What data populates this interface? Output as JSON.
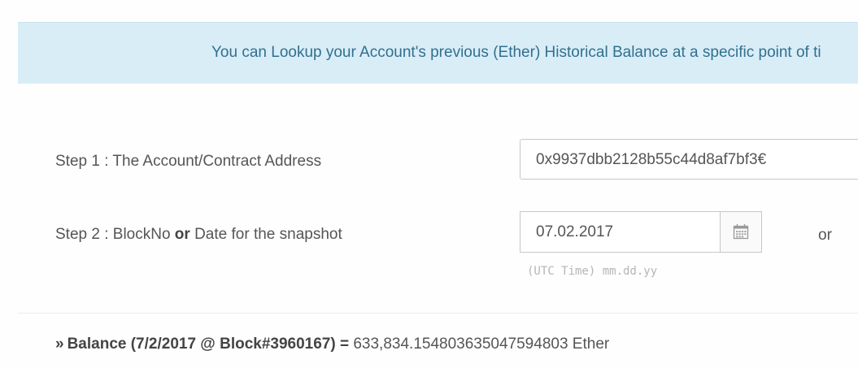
{
  "alert": {
    "text": "You can Lookup your Account's previous (Ether) Historical Balance at a specific point of ti"
  },
  "step1": {
    "label": "Step 1 : The Account/Contract Address",
    "address_value": "0x9937dbb2128b55c44d8af7bf3€"
  },
  "step2": {
    "label_prefix": "Step 2 : BlockNo ",
    "label_or": "or",
    "label_suffix": " Date for the snapshot",
    "date_value": "07.02.2017",
    "hint": "(UTC Time) mm.dd.yy",
    "or_text": "or"
  },
  "balance": {
    "chevron": "»",
    "label": "Balance (7/2/2017 @ Block#3960167) =",
    "value": " 633,834.154803635047594803 Ether"
  },
  "icons": {
    "calendar": "calendar-icon"
  }
}
